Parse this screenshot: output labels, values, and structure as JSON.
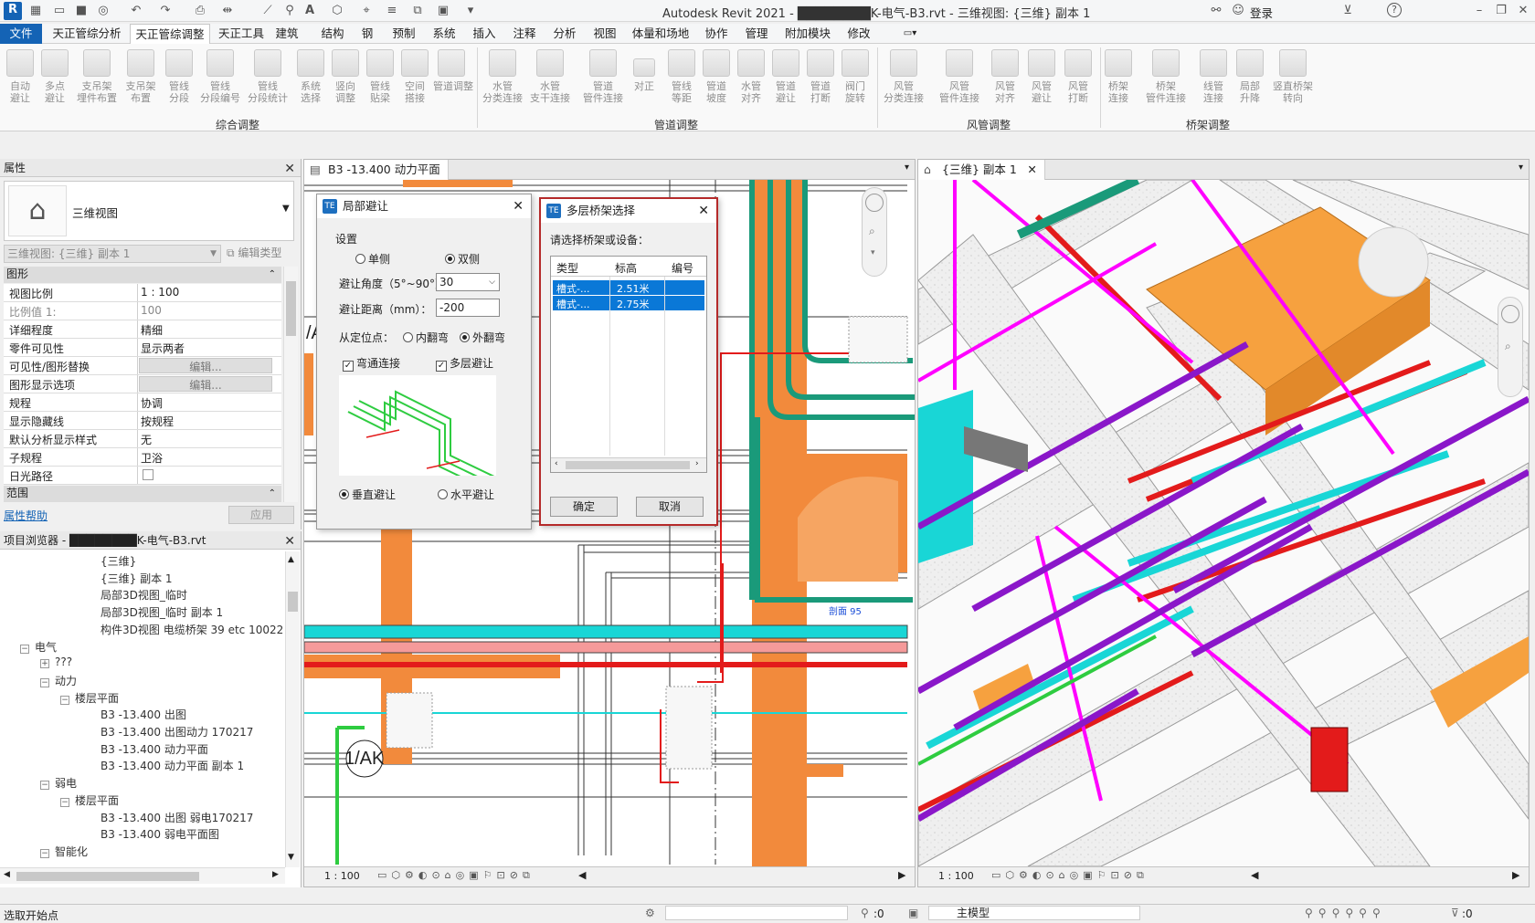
{
  "titlebar": {
    "title": "Autodesk Revit 2021 - ████████K-电气-B3.rvt - 三维视图: {三维} 副本 1",
    "login": "登录",
    "help": "?",
    "logo": "R"
  },
  "menubar": {
    "tabs": [
      "文件",
      "天正管综分析",
      "天正管综调整",
      "天正工具",
      "建筑",
      "结构",
      "钢",
      "预制",
      "系统",
      "插入",
      "注释",
      "分析",
      "视图",
      "体量和场地",
      "协作",
      "管理",
      "附加模块",
      "修改"
    ]
  },
  "ribbon": {
    "buttons": [
      "自动\n避让",
      "多点\n避让",
      "支吊架\n埋件布置",
      "支吊架\n布置",
      "管线\n分段",
      "管线\n分段编号",
      "管线\n分段统计",
      "系统\n选择",
      "竖向\n调整",
      "管线\n贴梁",
      "空间\n搭接",
      "管道调整",
      "水管\n分类连接",
      "水管\n支干连接",
      "管道\n管件连接",
      "对正",
      "管线\n等距",
      "管道\n坡度",
      "水管\n对齐",
      "管道\n避让",
      "管道\n打断",
      "阀门\n旋转",
      "风管\n分类连接",
      "风管\n管件连接",
      "风管\n对齐",
      "风管\n避让",
      "风管\n打断",
      "桥架\n连接",
      "桥架\n管件连接",
      "线管\n连接",
      "局部\n升降",
      "竖直桥架\n转向"
    ],
    "groups": [
      "综合调整",
      "管道调整",
      "风管调整",
      "桥架调整"
    ]
  },
  "properties": {
    "title": "属性",
    "type_name": "三维视图",
    "view_selector": "三维视图: {三维} 副本 1",
    "edit_type": "编辑类型",
    "section_graphics": "图形",
    "rows": [
      {
        "k": "视图比例",
        "v": "1 : 100"
      },
      {
        "k": "比例值 1:",
        "v": "100"
      },
      {
        "k": "详细程度",
        "v": "精细"
      },
      {
        "k": "零件可见性",
        "v": "显示两者"
      },
      {
        "k": "可见性/图形替换",
        "v": "编辑..."
      },
      {
        "k": "图形显示选项",
        "v": "编辑..."
      },
      {
        "k": "规程",
        "v": "协调"
      },
      {
        "k": "显示隐藏线",
        "v": "按规程"
      },
      {
        "k": "默认分析显示样式",
        "v": "无"
      },
      {
        "k": "子规程",
        "v": "卫浴"
      },
      {
        "k": "日光路径",
        "v": ""
      }
    ],
    "section_extents": "范围",
    "help_link": "属性帮助",
    "apply": "应用"
  },
  "browser": {
    "title": "项目浏览器 - ████████K-电气-B3.rvt",
    "items": [
      {
        "text": "{三维}",
        "lvl": 5
      },
      {
        "text": "{三维} 副本 1",
        "lvl": 5
      },
      {
        "text": "局部3D视图_临时",
        "lvl": 5
      },
      {
        "text": "局部3D视图_临时 副本 1",
        "lvl": 5
      },
      {
        "text": "构件3D视图 电缆桥架 39 etc 100226",
        "lvl": 5
      },
      {
        "text": "电气",
        "lvl": 1,
        "tw": "−"
      },
      {
        "text": "???",
        "lvl": 2,
        "tw": "+"
      },
      {
        "text": "动力",
        "lvl": 2,
        "tw": "−"
      },
      {
        "text": "楼层平面",
        "lvl": 3,
        "tw": "−"
      },
      {
        "text": "B3 -13.400 出图",
        "lvl": 5
      },
      {
        "text": "B3 -13.400 出图动力 170217",
        "lvl": 5
      },
      {
        "text": "B3 -13.400 动力平面",
        "lvl": 5
      },
      {
        "text": "B3 -13.400 动力平面 副本 1",
        "lvl": 5
      },
      {
        "text": "弱电",
        "lvl": 2,
        "tw": "−"
      },
      {
        "text": "楼层平面",
        "lvl": 3,
        "tw": "−"
      },
      {
        "text": "B3 -13.400 出图 弱电170217",
        "lvl": 5
      },
      {
        "text": "B3 -13.400 弱电平面图",
        "lvl": 5
      },
      {
        "text": "智能化",
        "lvl": 2,
        "tw": "−"
      }
    ]
  },
  "view2d": {
    "tab": "B3 -13.400 动力平面",
    "scale": "1 : 100",
    "label_axis": "1/AK",
    "label_a": "/A",
    "label_section": "剖面 95"
  },
  "view3d": {
    "tab": "{三维} 副本 1",
    "scale": "1 : 100"
  },
  "dialog_local": {
    "title": "局部避让",
    "settings": "设置",
    "single": "单侧",
    "double": "双侧",
    "angle_label": "避让角度（5°~90°）：",
    "angle_value": "30",
    "distance_label": "避让距离（mm）：",
    "distance_value": "-200",
    "anchor_label": "从定位点：",
    "inner": "内翻弯",
    "outer": "外翻弯",
    "elbow": "弯通连接",
    "multilayer": "多层避让",
    "vertical": "垂直避让",
    "horizontal": "水平避让"
  },
  "dialog_tray": {
    "title": "多层桥架选择",
    "prompt": "请选择桥架或设备：",
    "columns": [
      "类型",
      "标高",
      "编号"
    ],
    "rows": [
      {
        "type": "槽式-...",
        "elev": "2.51米",
        "id": ""
      },
      {
        "type": "槽式-...",
        "elev": "2.75米",
        "id": ""
      }
    ],
    "ok": "确定",
    "cancel": "取消"
  },
  "statusbar": {
    "text": "选取开始点",
    "zero1": ":0",
    "model": "主模型",
    "zero2": ":0"
  },
  "colors": {
    "accent": "#1463b5",
    "pipe_green": "#1a9a7a",
    "duct_orange": "#f28a3c",
    "tray_cyan": "#19d6d6",
    "tray_red": "#e31b1b",
    "magenta": "#ff00ff",
    "purple": "#8a17c9"
  }
}
